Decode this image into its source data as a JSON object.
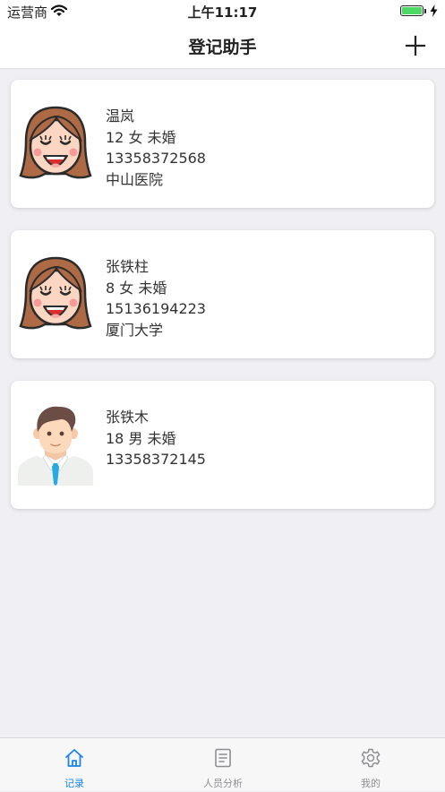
{
  "status_bar": {
    "carrier": "运营商",
    "time": "上午11:17"
  },
  "nav": {
    "title": "登记助手",
    "add_icon": "plus-icon"
  },
  "records": [
    {
      "name": "温岚",
      "detail": "12 女 未婚",
      "phone": "13358372568",
      "org": "中山医院",
      "avatar": "female-avatar"
    },
    {
      "name": "张铁柱",
      "detail": "8 女 未婚",
      "phone": "15136194223",
      "org": "厦门大学",
      "avatar": "female-avatar"
    },
    {
      "name": "张铁木",
      "detail": "18 男 未婚",
      "phone": "13358372145",
      "org": "",
      "avatar": "male-avatar"
    }
  ],
  "tabs": [
    {
      "label": "记录",
      "icon": "home-icon",
      "active": true
    },
    {
      "label": "人员分析",
      "icon": "document-icon",
      "active": false
    },
    {
      "label": "我的",
      "icon": "gear-icon",
      "active": false
    }
  ],
  "colors": {
    "accent": "#1a86e8",
    "background": "#efeff4",
    "battery": "#4cd964"
  }
}
